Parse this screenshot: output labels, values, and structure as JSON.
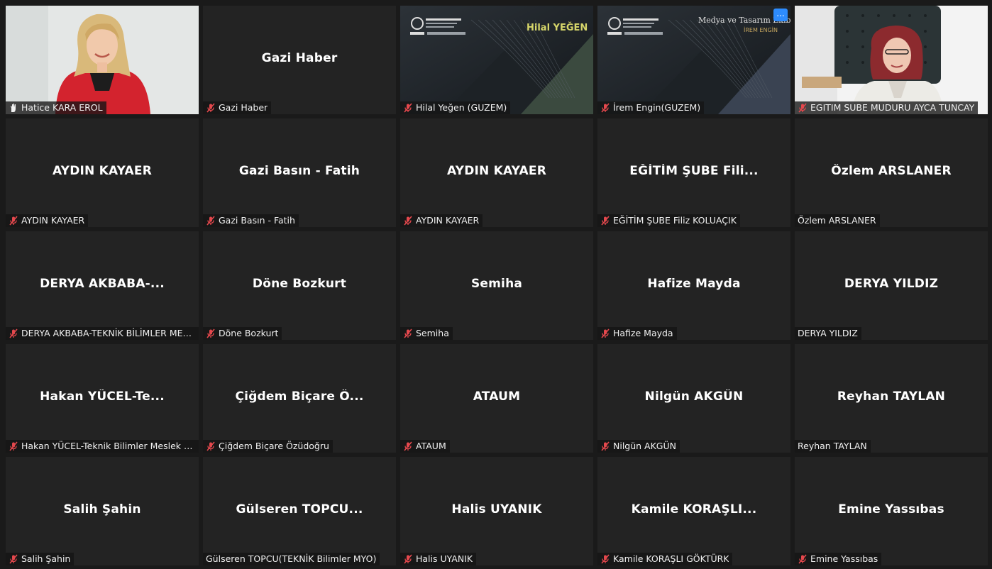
{
  "participants": [
    {
      "display": "",
      "label": "Hatice KARA EROL",
      "icon": "raised-hand-icon",
      "type": "video-woman",
      "speaking": true
    },
    {
      "display": "Gazi Haber",
      "label": "Gazi Haber",
      "icon": "muted-mic-icon",
      "type": "name"
    },
    {
      "display": "",
      "label": "Hilal Yeğen (GUZEM)",
      "icon": "muted-mic-icon",
      "type": "slide",
      "slide_name": "Hilal YEĞEN"
    },
    {
      "display": "",
      "label": "İrem Engin(GUZEM)",
      "icon": "muted-mic-icon",
      "type": "slide2",
      "slide_title": "Medya ve Tasarım Ekibi",
      "slide_name": "İREM ENGİN"
    },
    {
      "display": "",
      "label": "EGITIM SUBE MUDURU AYCA TUNCAY",
      "icon": "muted-mic-icon",
      "type": "video-office"
    },
    {
      "display": "AYDIN KAYAER",
      "label": "AYDIN KAYAER",
      "icon": "muted-mic-icon",
      "type": "name"
    },
    {
      "display": "Gazi Basın - Fatih",
      "label": "Gazi Basın - Fatih",
      "icon": "muted-mic-icon",
      "type": "name"
    },
    {
      "display": "AYDIN KAYAER",
      "label": "AYDIN KAYAER",
      "icon": "muted-mic-icon",
      "type": "name"
    },
    {
      "display": "EĞİTİM ŞUBE Fili...",
      "label": "EĞİTİM ŞUBE Filiz KOLUAÇIK",
      "icon": "muted-mic-icon",
      "type": "name"
    },
    {
      "display": "Özlem ARSLANER",
      "label": "Özlem ARSLANER",
      "icon": "",
      "type": "name"
    },
    {
      "display": "DERYA AKBABA-...",
      "label": "DERYA AKBABA-TEKNİK BİLİMLER MESLE...",
      "icon": "muted-mic-icon",
      "type": "name"
    },
    {
      "display": "Döne Bozkurt",
      "label": "Döne Bozkurt",
      "icon": "muted-mic-icon",
      "type": "name"
    },
    {
      "display": "Semiha",
      "label": "Semiha",
      "icon": "muted-mic-icon",
      "type": "name"
    },
    {
      "display": "Hafize Mayda",
      "label": "Hafize Mayda",
      "icon": "muted-mic-icon",
      "type": "name"
    },
    {
      "display": "DERYA YILDIZ",
      "label": "DERYA YILDIZ",
      "icon": "",
      "type": "name"
    },
    {
      "display": "Hakan YÜCEL-Te...",
      "label": "Hakan YÜCEL-Teknik Bilimler Meslek Yüks...",
      "icon": "muted-mic-icon",
      "type": "name"
    },
    {
      "display": "Çiğdem Biçare Ö...",
      "label": "Çiğdem Biçare Özüdoğru",
      "icon": "muted-mic-icon",
      "type": "name"
    },
    {
      "display": "ATAUM",
      "label": "ATAUM",
      "icon": "muted-mic-icon",
      "type": "name"
    },
    {
      "display": "Nilgün AKGÜN",
      "label": "Nilgün AKGÜN",
      "icon": "muted-mic-icon",
      "type": "name"
    },
    {
      "display": "Reyhan TAYLAN",
      "label": "Reyhan TAYLAN",
      "icon": "",
      "type": "name"
    },
    {
      "display": "Salih Şahin",
      "label": "Salih Şahin",
      "icon": "muted-mic-icon",
      "type": "name"
    },
    {
      "display": "Gülseren TOPCU...",
      "label": "Gülseren TOPCU(TEKNİK Bilimler MYO)",
      "icon": "",
      "type": "name"
    },
    {
      "display": "Halis UYANIK",
      "label": "Halis UYANIK",
      "icon": "muted-mic-icon",
      "type": "name"
    },
    {
      "display": "Kamile KORAŞLI...",
      "label": "Kamile KORAŞLI GÖKTÜRK",
      "icon": "muted-mic-icon",
      "type": "name"
    },
    {
      "display": "Emine Yassıbas",
      "label": "Emine Yassıbas",
      "icon": "muted-mic-icon",
      "type": "name"
    }
  ],
  "more_button": "...",
  "colors": {
    "speaking_border": "#d6f157",
    "tile_bg": "#232323",
    "muted_icon": "#e5484d",
    "more_button": "#2d8cff"
  }
}
